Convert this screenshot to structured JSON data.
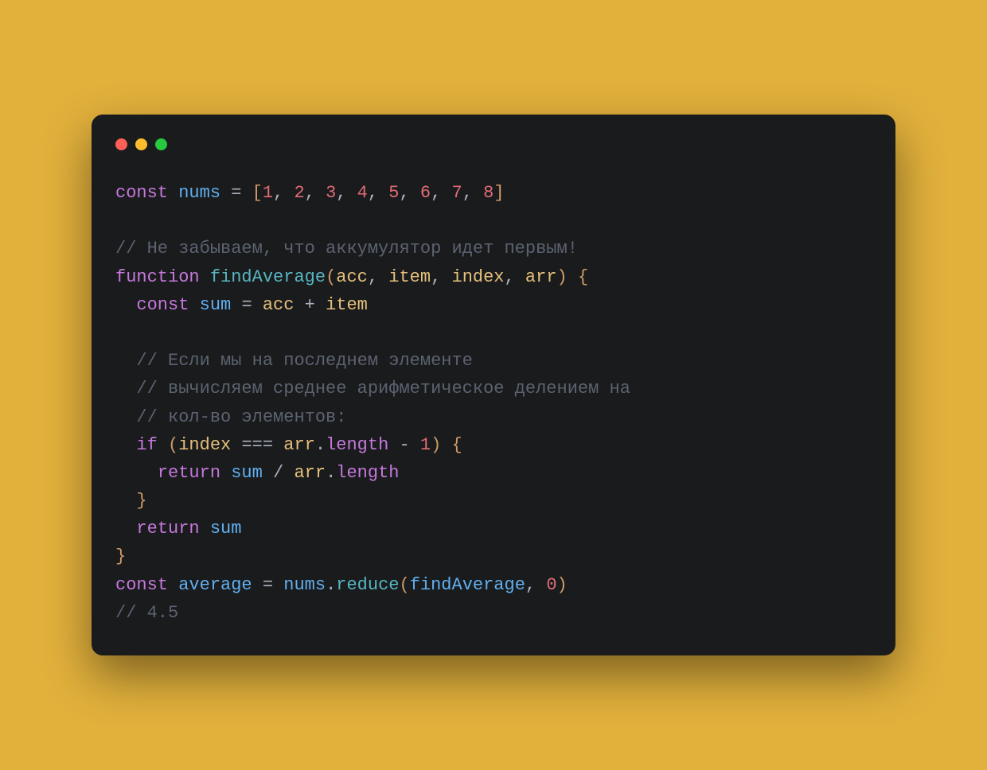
{
  "colors": {
    "background": "#e2b13c",
    "window": "#1a1b1d",
    "dots": {
      "red": "#ff5f56",
      "yellow": "#ffbd2e",
      "green": "#27c93f"
    },
    "keyword": "#c678dd",
    "variable": "#61afef",
    "function": "#56b6c2",
    "operator": "#abb2bf",
    "bracket": "#d19a66",
    "number": "#e06c75",
    "comment": "#5c6370",
    "param": "#e5c07b",
    "property": "#c678dd"
  },
  "code": {
    "plain": "const nums = [1, 2, 3, 4, 5, 6, 7, 8]\n\n// Не забываем, что аккумулятор идет первым!\nfunction findAverage(acc, item, index, arr) {\n  const sum = acc + item\n\n  // Если мы на последнем элементе\n  // вычисляем среднее арифметическое делением на\n  // кол-во элементов:\n  if (index === arr.length - 1) {\n    return sum / arr.length\n  }\n  return sum\n}\nconst average = nums.reduce(findAverage, 0)\n// 4.5",
    "tokens": [
      [
        [
          "kw",
          "const"
        ],
        [
          "op",
          " "
        ],
        [
          "var",
          "nums"
        ],
        [
          "op",
          " "
        ],
        [
          "op",
          "="
        ],
        [
          "op",
          " "
        ],
        [
          "brk",
          "["
        ],
        [
          "num",
          "1"
        ],
        [
          "punc",
          ", "
        ],
        [
          "num",
          "2"
        ],
        [
          "punc",
          ", "
        ],
        [
          "num",
          "3"
        ],
        [
          "punc",
          ", "
        ],
        [
          "num",
          "4"
        ],
        [
          "punc",
          ", "
        ],
        [
          "num",
          "5"
        ],
        [
          "punc",
          ", "
        ],
        [
          "num",
          "6"
        ],
        [
          "punc",
          ", "
        ],
        [
          "num",
          "7"
        ],
        [
          "punc",
          ", "
        ],
        [
          "num",
          "8"
        ],
        [
          "brk",
          "]"
        ]
      ],
      [],
      [
        [
          "cmt",
          "// Не забываем, что аккумулятор идет первым!"
        ]
      ],
      [
        [
          "kw",
          "function"
        ],
        [
          "op",
          " "
        ],
        [
          "fnc",
          "findAverage"
        ],
        [
          "brk",
          "("
        ],
        [
          "param",
          "acc"
        ],
        [
          "punc",
          ", "
        ],
        [
          "param",
          "item"
        ],
        [
          "punc",
          ", "
        ],
        [
          "param",
          "index"
        ],
        [
          "punc",
          ", "
        ],
        [
          "param",
          "arr"
        ],
        [
          "brk",
          ")"
        ],
        [
          "op",
          " "
        ],
        [
          "brk",
          "{"
        ]
      ],
      [
        [
          "op",
          "  "
        ],
        [
          "kw",
          "const"
        ],
        [
          "op",
          " "
        ],
        [
          "var",
          "sum"
        ],
        [
          "op",
          " "
        ],
        [
          "op",
          "="
        ],
        [
          "op",
          " "
        ],
        [
          "param",
          "acc"
        ],
        [
          "op",
          " "
        ],
        [
          "op",
          "+"
        ],
        [
          "op",
          " "
        ],
        [
          "param",
          "item"
        ]
      ],
      [],
      [
        [
          "op",
          "  "
        ],
        [
          "cmt",
          "// Если мы на последнем элементе"
        ]
      ],
      [
        [
          "op",
          "  "
        ],
        [
          "cmt",
          "// вычисляем среднее арифметическое делением на"
        ]
      ],
      [
        [
          "op",
          "  "
        ],
        [
          "cmt",
          "// кол-во элементов:"
        ]
      ],
      [
        [
          "op",
          "  "
        ],
        [
          "kw",
          "if"
        ],
        [
          "op",
          " "
        ],
        [
          "brk",
          "("
        ],
        [
          "param",
          "index"
        ],
        [
          "op",
          " "
        ],
        [
          "op",
          "==="
        ],
        [
          "op",
          " "
        ],
        [
          "param",
          "arr"
        ],
        [
          "punc",
          "."
        ],
        [
          "prop",
          "length"
        ],
        [
          "op",
          " "
        ],
        [
          "op",
          "-"
        ],
        [
          "op",
          " "
        ],
        [
          "num",
          "1"
        ],
        [
          "brk",
          ")"
        ],
        [
          "op",
          " "
        ],
        [
          "brk",
          "{"
        ]
      ],
      [
        [
          "op",
          "    "
        ],
        [
          "kw",
          "return"
        ],
        [
          "op",
          " "
        ],
        [
          "var",
          "sum"
        ],
        [
          "op",
          " "
        ],
        [
          "op",
          "/"
        ],
        [
          "op",
          " "
        ],
        [
          "param",
          "arr"
        ],
        [
          "punc",
          "."
        ],
        [
          "prop",
          "length"
        ]
      ],
      [
        [
          "op",
          "  "
        ],
        [
          "brk",
          "}"
        ]
      ],
      [
        [
          "op",
          "  "
        ],
        [
          "kw",
          "return"
        ],
        [
          "op",
          " "
        ],
        [
          "var",
          "sum"
        ]
      ],
      [
        [
          "brk",
          "}"
        ]
      ],
      [
        [
          "kw",
          "const"
        ],
        [
          "op",
          " "
        ],
        [
          "var",
          "average"
        ],
        [
          "op",
          " "
        ],
        [
          "op",
          "="
        ],
        [
          "op",
          " "
        ],
        [
          "var",
          "nums"
        ],
        [
          "punc",
          "."
        ],
        [
          "fnc",
          "reduce"
        ],
        [
          "brk",
          "("
        ],
        [
          "var",
          "findAverage"
        ],
        [
          "punc",
          ", "
        ],
        [
          "num",
          "0"
        ],
        [
          "brk",
          ")"
        ]
      ],
      [
        [
          "cmt",
          "// 4.5"
        ]
      ]
    ]
  }
}
